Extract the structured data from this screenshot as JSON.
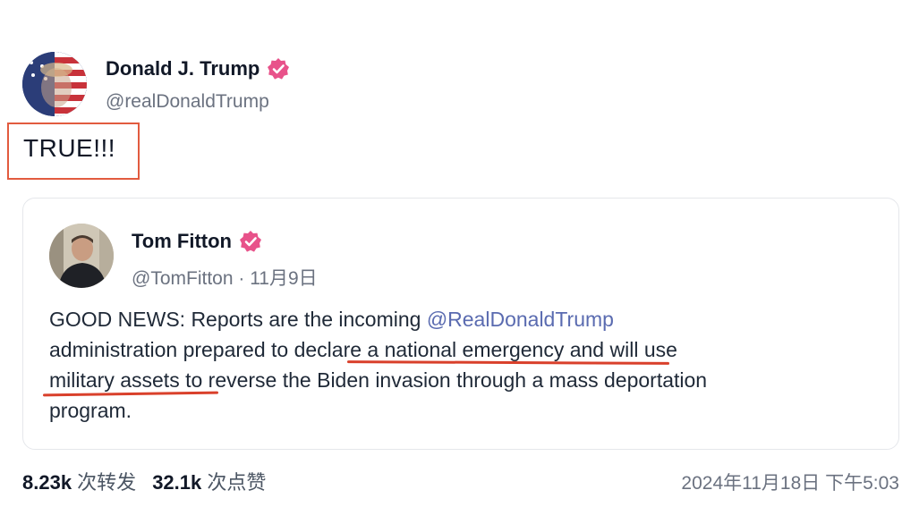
{
  "post": {
    "author": {
      "name": "Donald J. Trump",
      "handle": "@realDonaldTrump",
      "verified": true
    },
    "text": "TRUE!!!",
    "quote": {
      "author": {
        "name": "Tom Fitton",
        "handle": "@TomFitton",
        "separator": " · ",
        "date": "11月9日",
        "verified": true
      },
      "body": {
        "line1_text": "GOOD NEWS: Reports are the incoming ",
        "line1_mention": "@RealDonaldTrump",
        "line2": " administration prepared to declare a national emergency and will use",
        "line3": "military assets to reverse the Biden invasion through a mass deportation",
        "line4": "program."
      }
    },
    "stats": {
      "reposts_count": "8.23k",
      "reposts_label": " 次转发",
      "likes_count": "32.1k",
      "likes_label": " 次点赞"
    },
    "timestamp": "2024年11月18日 下午5:03"
  },
  "colors": {
    "verified_badge": "#e8528a",
    "highlight_box": "#e25b3f",
    "underline": "#d9402b",
    "mention": "#5a6bb0"
  },
  "icons": {
    "verified": "verified-badge-icon"
  }
}
